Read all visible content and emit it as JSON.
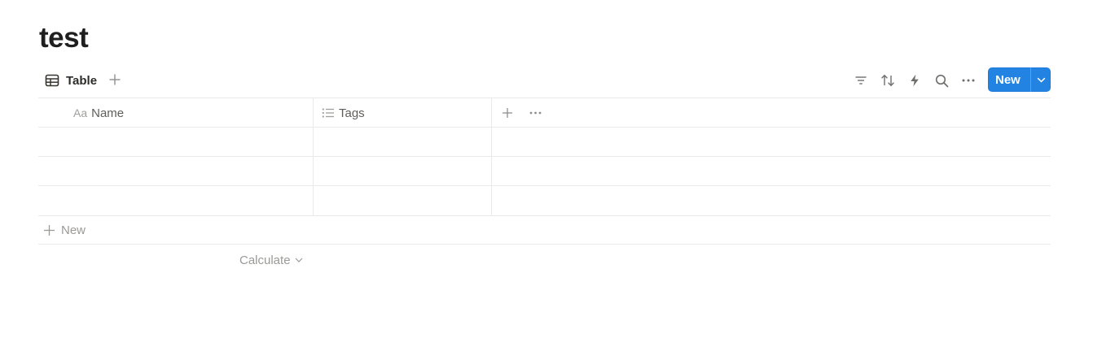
{
  "page": {
    "title": "test"
  },
  "view_bar": {
    "tab": {
      "label": "Table",
      "icon": "table-icon"
    },
    "add_view_icon": "plus-icon",
    "tools": [
      "filter-icon",
      "sort-icon",
      "automation-lightning-icon",
      "search-icon",
      "more-icon"
    ],
    "new_button": {
      "label": "New",
      "accent": "#2383e2",
      "caret_icon": "chevron-down-icon"
    }
  },
  "table": {
    "columns": [
      {
        "label": "Name",
        "type_icon": "Aa"
      },
      {
        "label": "Tags",
        "type_icon": "list-icon"
      }
    ],
    "add_property_icon": "plus-icon",
    "column_menu_icon": "more-icon",
    "rows": [
      {
        "Name": "",
        "Tags": ""
      },
      {
        "Name": "",
        "Tags": ""
      },
      {
        "Name": "",
        "Tags": ""
      }
    ],
    "new_row_label": "New",
    "calculate_label": "Calculate"
  }
}
